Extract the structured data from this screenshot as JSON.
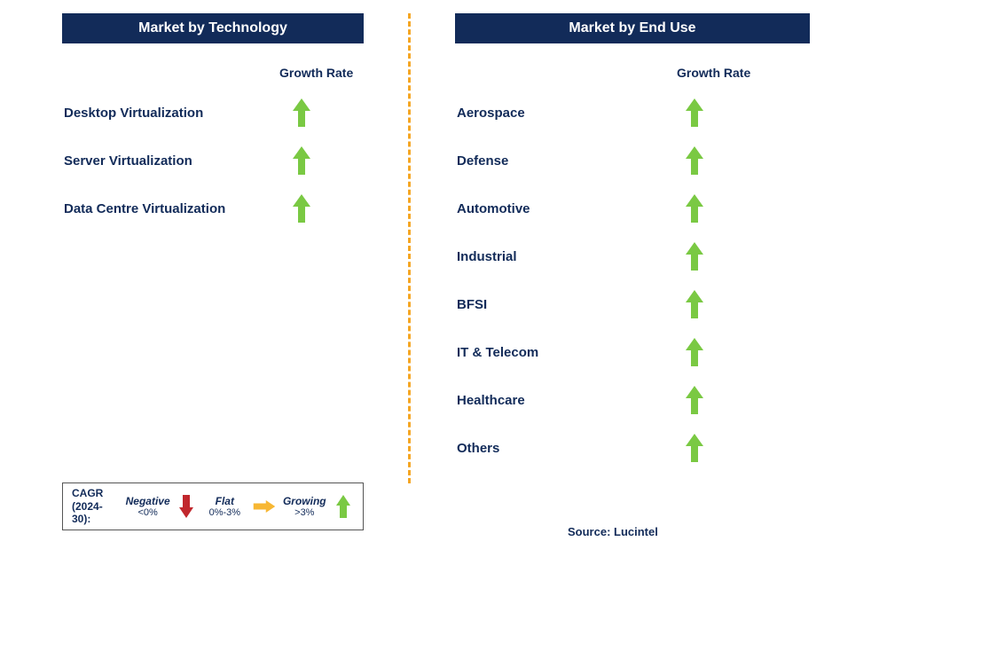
{
  "left": {
    "header": "Market by Technology",
    "growth_rate_label": "Growth Rate",
    "rows": [
      {
        "label": "Desktop Virtualization",
        "growth": "growing"
      },
      {
        "label": "Server Virtualization",
        "growth": "growing"
      },
      {
        "label": "Data Centre Virtualization",
        "growth": "growing"
      }
    ]
  },
  "right": {
    "header": "Market by End Use",
    "growth_rate_label": "Growth Rate",
    "rows": [
      {
        "label": "Aerospace",
        "growth": "growing"
      },
      {
        "label": "Defense",
        "growth": "growing"
      },
      {
        "label": "Automotive",
        "growth": "growing"
      },
      {
        "label": "Industrial",
        "growth": "growing"
      },
      {
        "label": "BFSI",
        "growth": "growing"
      },
      {
        "label": "IT & Telecom",
        "growth": "growing"
      },
      {
        "label": "Healthcare",
        "growth": "growing"
      },
      {
        "label": "Others",
        "growth": "growing"
      }
    ]
  },
  "legend": {
    "cagr_label_line1": "CAGR",
    "cagr_label_line2": "(2024-30):",
    "negative_title": "Negative",
    "negative_sub": "<0%",
    "flat_title": "Flat",
    "flat_sub": "0%-3%",
    "growing_title": "Growing",
    "growing_sub": ">3%"
  },
  "source": "Source: Lucintel",
  "chart_data": {
    "type": "table",
    "title": "Market Growth Rate Indicators",
    "legend_definition": {
      "negative": "<0%",
      "flat": "0%-3%",
      "growing": ">3%",
      "period": "CAGR (2024-30)"
    },
    "panels": [
      {
        "name": "Market by Technology",
        "metric": "Growth Rate",
        "rows": [
          {
            "category": "Desktop Virtualization",
            "growth_rate": "growing"
          },
          {
            "category": "Server Virtualization",
            "growth_rate": "growing"
          },
          {
            "category": "Data Centre Virtualization",
            "growth_rate": "growing"
          }
        ]
      },
      {
        "name": "Market by End Use",
        "metric": "Growth Rate",
        "rows": [
          {
            "category": "Aerospace",
            "growth_rate": "growing"
          },
          {
            "category": "Defense",
            "growth_rate": "growing"
          },
          {
            "category": "Automotive",
            "growth_rate": "growing"
          },
          {
            "category": "Industrial",
            "growth_rate": "growing"
          },
          {
            "category": "BFSI",
            "growth_rate": "growing"
          },
          {
            "category": "IT & Telecom",
            "growth_rate": "growing"
          },
          {
            "category": "Healthcare",
            "growth_rate": "growing"
          },
          {
            "category": "Others",
            "growth_rate": "growing"
          }
        ]
      }
    ]
  }
}
